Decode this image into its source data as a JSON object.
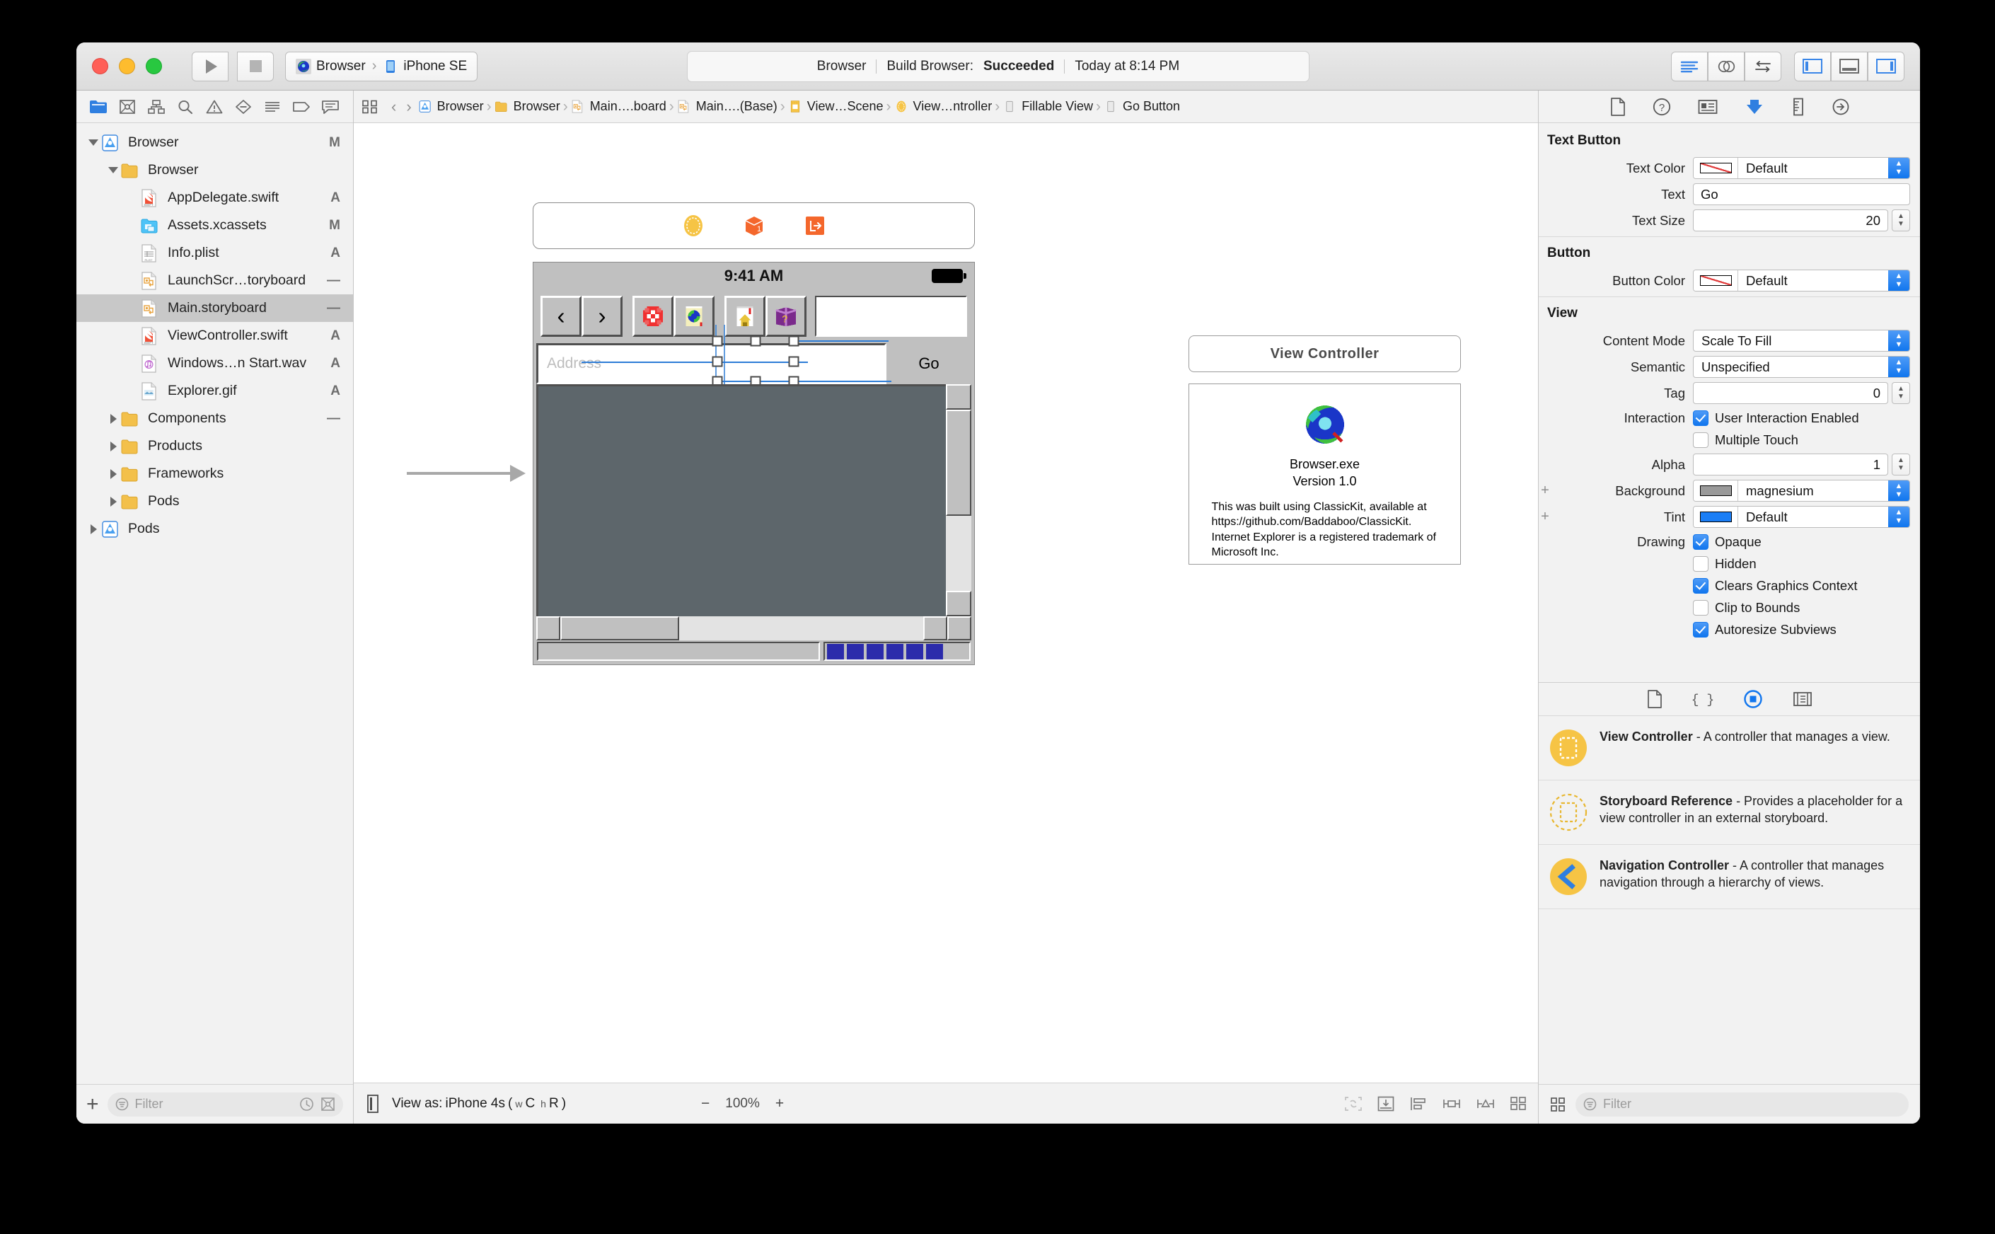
{
  "window": {
    "traffic_lights": [
      "close",
      "minimize",
      "zoom"
    ]
  },
  "toolbar": {
    "run_button": "run",
    "stop_button": "stop",
    "scheme_target": "Browser",
    "scheme_device": "iPhone SE",
    "scheme_separator": "›",
    "status": {
      "project": "Browser",
      "activity": "Build Browser:",
      "result": "Succeeded",
      "time": "Today at 8:14 PM"
    },
    "editor_modes": [
      "standard-editor-icon",
      "assistant-editor-icon",
      "version-editor-icon"
    ],
    "panel_toggles": [
      "navigator-toggle-icon",
      "debug-area-toggle-icon",
      "inspector-toggle-icon"
    ]
  },
  "navigator": {
    "tabs": [
      "project-navigator-icon",
      "source-control-navigator-icon",
      "symbol-navigator-icon",
      "find-navigator-icon",
      "issue-navigator-icon",
      "test-navigator-icon",
      "debug-navigator-icon",
      "breakpoint-navigator-icon",
      "report-navigator-icon"
    ],
    "active_tab": 0,
    "tree": [
      {
        "label": "Browser",
        "status": "M",
        "depth": 0,
        "twisty": "down",
        "icon": "xcode-project-icon"
      },
      {
        "label": "Browser",
        "status": "",
        "depth": 1,
        "twisty": "down",
        "icon": "folder-icon"
      },
      {
        "label": "AppDelegate.swift",
        "status": "A",
        "depth": 2,
        "twisty": "none",
        "icon": "swift-file-icon"
      },
      {
        "label": "Assets.xcassets",
        "status": "M",
        "depth": 2,
        "twisty": "none",
        "icon": "assets-catalog-icon"
      },
      {
        "label": "Info.plist",
        "status": "A",
        "depth": 2,
        "twisty": "none",
        "icon": "plist-file-icon"
      },
      {
        "label": "LaunchScr…toryboard",
        "status": "—",
        "depth": 2,
        "twisty": "none",
        "icon": "storyboard-file-icon"
      },
      {
        "label": "Main.storyboard",
        "status": "—",
        "depth": 2,
        "twisty": "none",
        "icon": "storyboard-file-icon",
        "selected": true
      },
      {
        "label": "ViewController.swift",
        "status": "A",
        "depth": 2,
        "twisty": "none",
        "icon": "swift-file-icon"
      },
      {
        "label": "Windows…n Start.wav",
        "status": "A",
        "depth": 2,
        "twisty": "none",
        "icon": "audio-file-icon"
      },
      {
        "label": "Explorer.gif",
        "status": "A",
        "depth": 2,
        "twisty": "none",
        "icon": "image-file-icon"
      },
      {
        "label": "Components",
        "status": "—",
        "depth": 1,
        "twisty": "right",
        "icon": "folder-icon"
      },
      {
        "label": "Products",
        "status": "",
        "depth": 1,
        "twisty": "right",
        "icon": "folder-icon"
      },
      {
        "label": "Frameworks",
        "status": "",
        "depth": 1,
        "twisty": "right",
        "icon": "folder-icon"
      },
      {
        "label": "Pods",
        "status": "",
        "depth": 1,
        "twisty": "right",
        "icon": "folder-icon"
      },
      {
        "label": "Pods",
        "status": "",
        "depth": 0,
        "twisty": "right",
        "icon": "xcode-project-icon"
      }
    ],
    "add_button": "+",
    "filter_placeholder": "Filter",
    "filter_value": "",
    "recent_icon": "clock-icon",
    "sourcecontrol_icon": "source-control-filter-icon"
  },
  "jumpbar": {
    "related_icon": "related-items-icon",
    "back": "‹",
    "forward": "›",
    "items": [
      {
        "label": "Browser",
        "icon": "xcode-project-icon"
      },
      {
        "label": "Browser",
        "icon": "folder-icon"
      },
      {
        "label": "Main….board",
        "icon": "storyboard-file-icon"
      },
      {
        "label": "Main….(Base)",
        "icon": "storyboard-file-icon"
      },
      {
        "label": "View…Scene",
        "icon": "scene-icon"
      },
      {
        "label": "View…ntroller",
        "icon": "view-controller-icon"
      },
      {
        "label": "Fillable View",
        "icon": "view-icon"
      },
      {
        "label": "Go Button",
        "icon": "button-icon"
      }
    ]
  },
  "canvas": {
    "scene_dock": [
      "view-controller-icon",
      "first-responder-icon",
      "exit-icon"
    ],
    "device": {
      "status_time": "9:41 AM",
      "battery_icon": "battery-full-icon",
      "toolbar_buttons": [
        {
          "name": "back-button",
          "glyph": "‹"
        },
        {
          "name": "forward-button",
          "glyph": "›"
        },
        {
          "name": "stop-button",
          "glyph": ""
        },
        {
          "name": "refresh-button",
          "glyph": ""
        },
        {
          "name": "home-button",
          "glyph": ""
        },
        {
          "name": "help-button",
          "glyph": ""
        }
      ],
      "address_placeholder": "Address",
      "address_value": "",
      "go_label": "Go",
      "progress_blocks": 6
    },
    "about_scene": {
      "title": "View Controller",
      "app_name": "Browser.exe",
      "version": "Version 1.0",
      "description": "This was built using ClassicKit, available at https://github.com/Baddaboo/ClassicKit. Internet Explorer is a registered trademark of Microsoft Inc.",
      "icon": "internet-explorer-globe-icon"
    }
  },
  "canvas_bottom": {
    "device_toggle_icon": "device-preview-icon",
    "view_as_prefix": "View as:",
    "view_as_device": "iPhone 4s",
    "view_as_traits_open": "(",
    "view_as_w_sub": "w",
    "view_as_w": "C",
    "view_as_h_sub": "h",
    "view_as_h": "R",
    "view_as_traits_close": ")",
    "zoom_out": "−",
    "zoom_level": "100%",
    "zoom_in": "+",
    "autolayout_icons": [
      "update-frames-icon",
      "embed-in-icon",
      "align-icon",
      "pin-icon",
      "resolve-autolayout-icon"
    ],
    "library_grid_icon": "library-grid-icon"
  },
  "inspector": {
    "tabs": [
      "file-inspector-icon",
      "quick-help-inspector-icon",
      "identity-inspector-icon",
      "attributes-inspector-icon",
      "size-inspector-icon",
      "connections-inspector-icon"
    ],
    "active_tab": 3,
    "sections": [
      {
        "title": "Text Button",
        "rows": [
          {
            "kind": "combo",
            "label": "Text Color",
            "value": "Default",
            "swatch": "diag"
          },
          {
            "kind": "text",
            "label": "Text",
            "value": "Go",
            "align": "left"
          },
          {
            "kind": "stepper",
            "label": "Text Size",
            "value": "20"
          }
        ]
      },
      {
        "title": "Button",
        "rows": [
          {
            "kind": "combo",
            "label": "Button Color",
            "value": "Default",
            "swatch": "diag"
          }
        ]
      },
      {
        "title": "View",
        "rows": [
          {
            "kind": "combo",
            "label": "Content Mode",
            "value": "Scale To Fill",
            "swatch": "none"
          },
          {
            "kind": "combo",
            "label": "Semantic",
            "value": "Unspecified",
            "swatch": "none"
          },
          {
            "kind": "stepper",
            "label": "Tag",
            "value": "0"
          },
          {
            "kind": "checks",
            "label": "Interaction",
            "items": [
              {
                "text": "User Interaction Enabled",
                "checked": true
              },
              {
                "text": "Multiple Touch",
                "checked": false
              }
            ]
          },
          {
            "kind": "stepper",
            "label": "Alpha",
            "value": "1"
          },
          {
            "kind": "combo",
            "label": "Background",
            "value": "magnesium",
            "swatch": "gray",
            "plus": true
          },
          {
            "kind": "combo",
            "label": "Tint",
            "value": "Default",
            "swatch": "blue",
            "plus": true
          },
          {
            "kind": "checks",
            "label": "Drawing",
            "items": [
              {
                "text": "Opaque",
                "checked": true
              },
              {
                "text": "Hidden",
                "checked": false,
                "plus": true
              },
              {
                "text": "Clears Graphics Context",
                "checked": true
              },
              {
                "text": "Clip to Bounds",
                "checked": false
              },
              {
                "text": "Autoresize Subviews",
                "checked": true
              }
            ]
          }
        ]
      }
    ],
    "library": {
      "tabs": [
        "file-template-library-icon",
        "code-snippet-library-icon",
        "object-library-icon",
        "media-library-icon"
      ],
      "active_tab": 2,
      "items": [
        {
          "name": "View Controller",
          "desc": " - A controller that manages a view.",
          "icon": "view-controller-library-icon"
        },
        {
          "name": "Storyboard Reference",
          "desc": " - Provides a placeholder for a view controller in an external storyboard.",
          "icon": "storyboard-reference-library-icon"
        },
        {
          "name": "Navigation Controller",
          "desc": " - A controller that manages navigation through a hierarchy of views.",
          "icon": "navigation-controller-library-icon"
        }
      ],
      "filter_placeholder": "Filter",
      "filter_value": ""
    }
  },
  "colors": {
    "accent": "#1176ee",
    "selection": "#2d7cd6",
    "library_yellow": "#f6c445",
    "chrome": "#c0c0c0",
    "page": "#5d666b"
  }
}
